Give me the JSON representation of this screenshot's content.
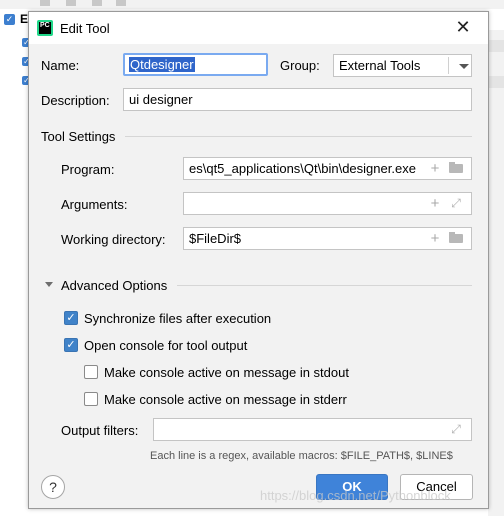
{
  "background": {
    "first_item_letter": "E",
    "check_mark": "✓"
  },
  "dialog": {
    "title": "Edit Tool",
    "app_icon_text": "PC",
    "close_symbol": "✕",
    "name": {
      "label": "Name:",
      "value": "Qtdesigner"
    },
    "group": {
      "label": "Group:",
      "value": "External Tools"
    },
    "description": {
      "label": "Description:",
      "value": "ui designer"
    },
    "tool_settings": {
      "title": "Tool Settings",
      "program": {
        "label": "Program:",
        "value": "es\\qt5_applications\\Qt\\bin\\designer.exe"
      },
      "arguments": {
        "label": "Arguments:",
        "value": ""
      },
      "working_directory": {
        "label": "Working directory:",
        "value": "$FileDir$"
      }
    },
    "advanced_options": {
      "title": "Advanced Options",
      "expanded": true,
      "options": [
        {
          "label": "Synchronize files after execution",
          "checked": true
        },
        {
          "label": "Open console for tool output",
          "checked": true
        },
        {
          "label": "Make console active on message in stdout",
          "checked": false
        },
        {
          "label": "Make console active on message in stderr",
          "checked": false
        }
      ],
      "output_filters": {
        "label": "Output filters:",
        "value": "",
        "hint": "Each line is a regex, available macros: $FILE_PATH$, $LINE$"
      }
    },
    "buttons": {
      "help": "?",
      "ok": "OK",
      "cancel": "Cancel"
    },
    "icons": {
      "plus": "+",
      "expand": "⤢",
      "check": "✓"
    }
  },
  "watermark": "https://blog.csdn.net/Pythonblock",
  "colors": {
    "accent": "#3f83d9",
    "selection": "#2f65ca",
    "dialog_bg": "#f2f2f2",
    "focus_border": "#7aaaf0"
  }
}
